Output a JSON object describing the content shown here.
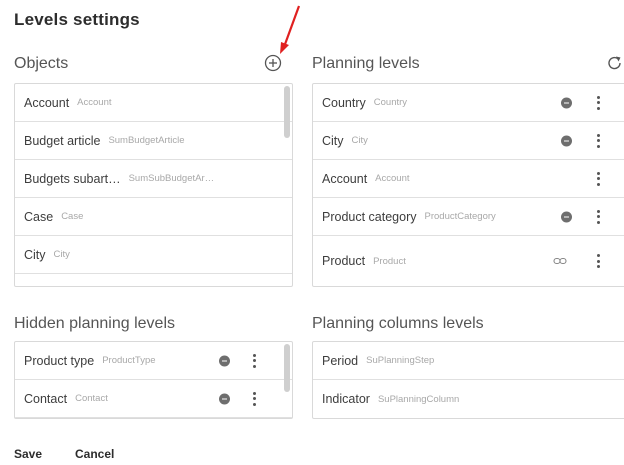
{
  "title": "Levels settings",
  "objects": {
    "title": "Objects",
    "add_icon": "plus-circle-icon",
    "items": [
      {
        "name": "Account",
        "code": "Account"
      },
      {
        "name": "Budget article",
        "code": "SumBudgetArticle"
      },
      {
        "name": "Budgets subart…",
        "code": "SumSubBudgetAr…"
      },
      {
        "name": "Case",
        "code": "Case"
      },
      {
        "name": "City",
        "code": "City"
      }
    ]
  },
  "planning_levels": {
    "title": "Planning levels",
    "refresh_icon": "refresh-icon",
    "items": [
      {
        "name": "Country",
        "code": "Country",
        "icon": "minus-circle-icon"
      },
      {
        "name": "City",
        "code": "City",
        "icon": "minus-circle-icon"
      },
      {
        "name": "Account",
        "code": "Account",
        "icon": ""
      },
      {
        "name": "Product category",
        "code": "ProductCategory",
        "icon": "minus-circle-icon"
      },
      {
        "name": "Product",
        "code": "Product",
        "icon": "link-icon"
      }
    ]
  },
  "hidden_levels": {
    "title": "Hidden planning levels",
    "items": [
      {
        "name": "Product type",
        "code": "ProductType",
        "icon": "minus-circle-icon"
      },
      {
        "name": "Contact",
        "code": "Contact",
        "icon": "minus-circle-icon"
      }
    ]
  },
  "columns_levels": {
    "title": "Planning columns levels",
    "items": [
      {
        "name": "Period",
        "code": "SuPlanningStep"
      },
      {
        "name": "Indicator",
        "code": "SuPlanningColumn"
      }
    ]
  },
  "actions": {
    "save": "Save",
    "cancel": "Cancel"
  },
  "colors": {
    "annotation_arrow": "#e02020",
    "border": "#d9d9d9",
    "muted_text": "#a8a8a8"
  }
}
